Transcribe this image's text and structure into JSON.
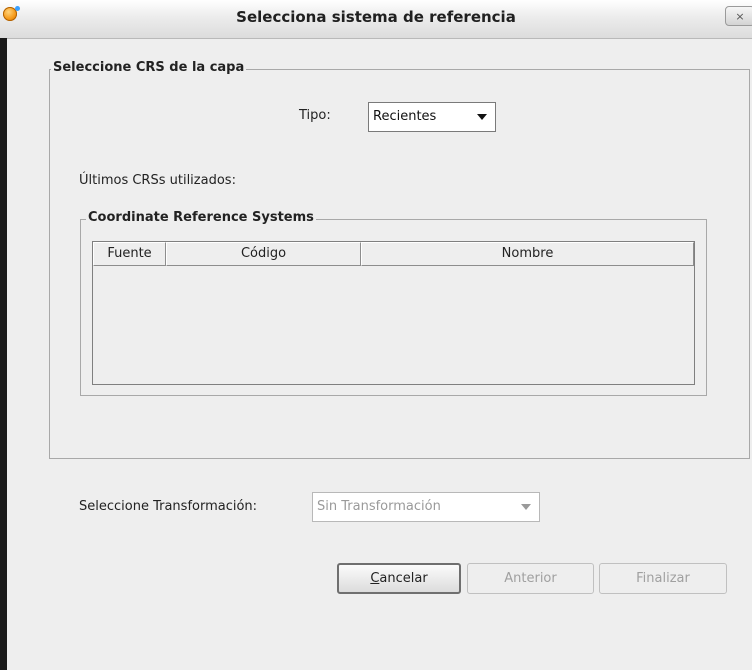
{
  "window": {
    "title": "Selecciona sistema de referencia",
    "close_label": "×"
  },
  "crs_group": {
    "legend": "Seleccione CRS de la capa",
    "tipo_label": "Tipo:",
    "tipo_value": "Recientes",
    "recent_label": "Últimos CRSs utilizados:",
    "systems_group": {
      "legend": "Coordinate Reference Systems",
      "columns": [
        "Fuente",
        "Código",
        "Nombre"
      ],
      "rows": []
    }
  },
  "transformation": {
    "label": "Seleccione Transformación:",
    "value": "Sin Transformación"
  },
  "buttons": {
    "cancel_mnemonic": "C",
    "cancel_rest": "ancelar",
    "previous": "Anterior",
    "finish": "Finalizar"
  },
  "icons": {
    "app": "gvsig-app-icon",
    "close": "close-icon",
    "dropdown": "chevron-down-icon"
  }
}
